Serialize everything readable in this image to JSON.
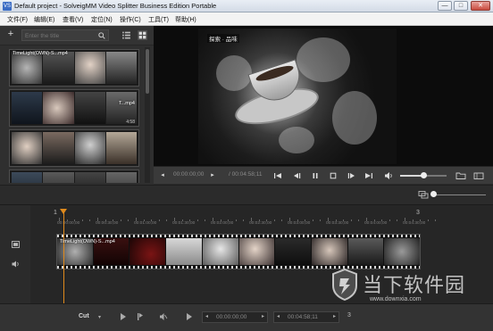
{
  "window": {
    "app_icon": "VS",
    "title": "Default project - SolveigMM Video Splitter Business Edition Portable",
    "buttons": [
      "—",
      "□",
      "✕"
    ]
  },
  "menu": [
    "文件(F)",
    "编辑(E)",
    "查看(V)",
    "定位(N)",
    "操作(C)",
    "工具(T)",
    "帮助(H)"
  ],
  "library": {
    "add_icon": "+",
    "search_placeholder": "Enter the title",
    "clips": [
      {
        "name": "TimeLight(OWN)-S...mp4",
        "name2": "",
        "duration": ""
      },
      {
        "name": "",
        "name2": "T...mp4",
        "duration": "4:58"
      },
      {
        "name": "",
        "name2": "",
        "duration": ""
      },
      {
        "name": "",
        "name2": "",
        "duration": ""
      }
    ]
  },
  "preview": {
    "caption": "探索 · 品味"
  },
  "player": {
    "current_time": "00:00:00;00",
    "total_time": "/ 00:04:58;11",
    "volume": 0.5
  },
  "timeline": {
    "ruler_labels": [
      "00:00:00;00",
      "00:00:30;00",
      "00:01:00;00",
      "00:01:30;00",
      "00:02:00;00",
      "00:02:30;00",
      "00:03:00;00",
      "00:03:30;00",
      "00:04:00;00",
      "00:04:30;00"
    ],
    "start_marker": "1",
    "end_marker": "3",
    "clip_name": "TimeLight(OWN)-S...mp4"
  },
  "bottom": {
    "mode": "Cut",
    "start_time": "00:00:00;00",
    "end_time": "00:04:58;11",
    "marker": "3"
  },
  "watermark": {
    "text": "当下软件园",
    "url": "www.downxia.com"
  }
}
